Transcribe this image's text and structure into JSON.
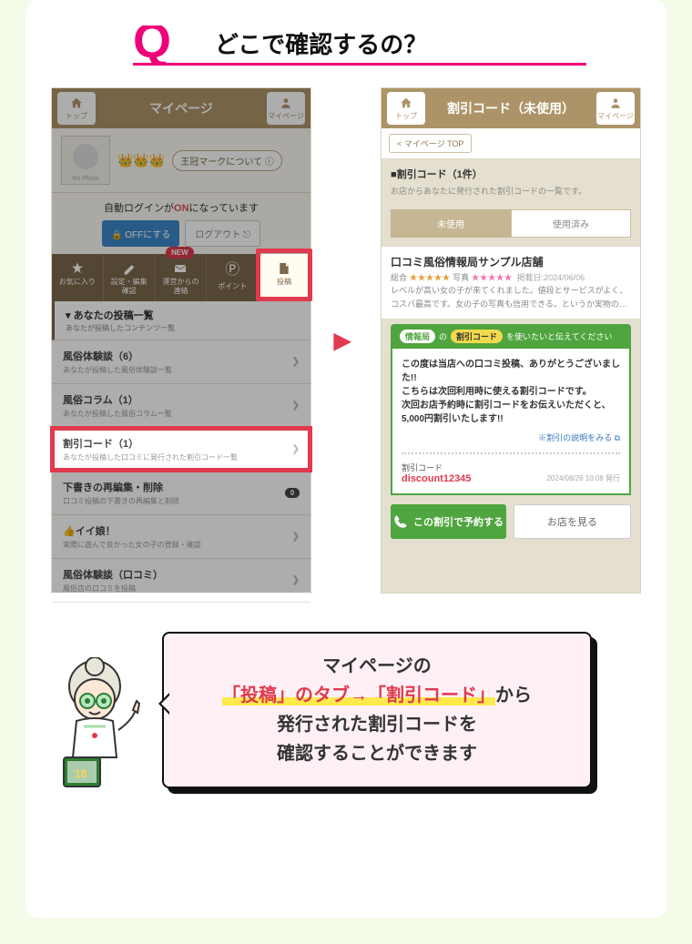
{
  "q_marker": "Q",
  "q_title": "どこで確認するの？",
  "arrow": "▶",
  "phone1": {
    "nav": {
      "top": "トップ",
      "title": "マイページ",
      "mypage": "マイページ"
    },
    "avatar_label": "No Photo",
    "crowns": "👑👑👑",
    "crown_btn": "王冠マークについて ⓘ",
    "login_line_pre": "自動ログインが",
    "login_on": "ON",
    "login_line_post": "になっています",
    "btn_off": "🔒 OFFにする",
    "btn_logout": "ログアウト ⎋",
    "tabs": {
      "fav": "お気に入り",
      "edit": "設定・編集\n確認",
      "notice": "運営からの\n連絡",
      "new_badge": "NEW",
      "point": "ポイント",
      "point_icon": "Ⓟ",
      "post": "投稿"
    },
    "list": {
      "hdr_title": "あなたの投稿一覧",
      "hdr_sub": "あなたが投稿したコンテンツ一覧",
      "item1_title": "風俗体験談（6）",
      "item1_sub": "あなたが投稿した風俗体験談一覧",
      "item2_title": "風俗コラム（1）",
      "item2_sub": "あなたが投稿した風俗コラム一覧",
      "item3_title": "割引コード（1）",
      "item3_sub": "あなたが投稿した口コミに発行された割引コード一覧",
      "item4_title": "下書きの再編集・削除",
      "item4_sub": "口コミ投稿の下書きの再編集と削除",
      "item4_badge": "0",
      "item5_title": "👍イイ娘！",
      "item5_sub": "実際に遊んで良かった女の子の登録・確認",
      "item6_title": "風俗体験談（口コミ）",
      "item6_sub": "風俗店の口コミを投稿"
    }
  },
  "phone2": {
    "nav": {
      "top": "トップ",
      "title": "割引コード（未使用）",
      "mypage": "マイページ"
    },
    "crumb": "< マイページ TOP",
    "hdr": "■割引コード（1件）",
    "sub": "お店からあなたに発行された割引コードの一覧です。",
    "seg_unused": "未使用",
    "seg_used": "使用済み",
    "store_title": "口コミ風俗情報局サンプル店舗",
    "stars_lbl_total": "総合",
    "stars_total": "★★★★★",
    "stars_lbl_photo": "写真",
    "stars_photo": "★★★★★",
    "post_date": "掲載日:2024/06/06",
    "review_line1": "レベルが高い女の子が来てくれました。値段とサービスがよく、",
    "review_line2": "コスパ最高です。女の子の写真も信用できる。というか実物の…",
    "banner_pill1": "情報局",
    "banner_no": "の",
    "banner_pill2": "割引コード",
    "banner_rest": "を使いたいと伝えてください",
    "msg1": "この度は当店への口コミ投稿、ありがとうございました!!",
    "msg2": "こちらは次回利用時に使える割引コードです。",
    "msg3": "次回お店予約時に割引コードをお伝えいただくと、5,000円割引いたします!!",
    "link_expl": "※割引の説明をみる ⧉",
    "code_label": "割引コード",
    "code_value": "discount12345",
    "code_issued": "2024/08/26 10:08 発行",
    "cta_reserve": "この割引で予約する",
    "cta_view": "お店を見る"
  },
  "bubble": {
    "line1": "マイページの",
    "line2_hl": "「投稿」のタブ→「割引コード」",
    "line2_post": "から",
    "line3": "発行された割引コードを",
    "line4": "確認することができます"
  }
}
